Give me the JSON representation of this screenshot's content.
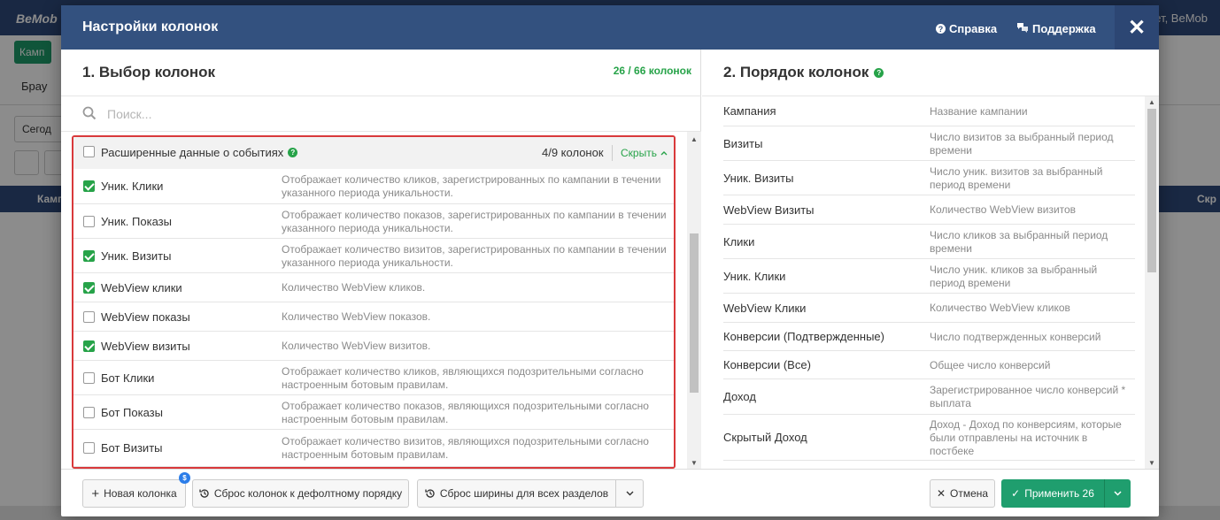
{
  "background": {
    "logo": "BeMob",
    "user_text": "ет, BeMob",
    "campaign_button": "Камп",
    "browser_label": "Брау",
    "date_label": "Сегод",
    "table_col_left": "Камп",
    "table_col_right": "Скр"
  },
  "modal": {
    "title": "Настройки колонок",
    "help_label": "Справка",
    "support_label": "Поддержка",
    "close_symbol": "✕"
  },
  "left": {
    "title": "1. Выбор колонок",
    "count": "26 / 66 колонок",
    "search_placeholder": "Поиск...",
    "group": {
      "label": "Расширенные данные о событиях",
      "count": "4/9 колонок",
      "hide_label": "Скрыть",
      "checked": false
    },
    "rows": [
      {
        "name": "Уник. Клики",
        "checked": true,
        "desc": "Отображает количество кликов, зарегистрированных по кампании в течении указанного периода уникальности."
      },
      {
        "name": "Уник. Показы",
        "checked": false,
        "desc": "Отображает количество показов, зарегистрированных по кампании в течении указанного периода уникальности."
      },
      {
        "name": "Уник. Визиты",
        "checked": true,
        "desc": "Отображает количество визитов, зарегистрированных по кампании в течении указанного периода уникальности."
      },
      {
        "name": "WebView клики",
        "checked": true,
        "desc": "Количество WebView кликов."
      },
      {
        "name": "WebView показы",
        "checked": false,
        "desc": "Количество WebView показов."
      },
      {
        "name": "WebView визиты",
        "checked": true,
        "desc": "Количество WebView визитов."
      },
      {
        "name": "Бот Клики",
        "checked": false,
        "desc": "Отображает количество кликов, являющихся подозрительными согласно настроенным ботовым правилам."
      },
      {
        "name": "Бот Показы",
        "checked": false,
        "desc": "Отображает количество показов, являющихся подозрительными согласно настроенным ботовым правилам."
      },
      {
        "name": "Бот Визиты",
        "checked": false,
        "desc": "Отображает количество визитов, являющихся подозрительными согласно настроенным ботовым правилам."
      }
    ]
  },
  "right": {
    "title": "2. Порядок колонок",
    "rows": [
      {
        "name": "Кампания",
        "desc": "Название кампании"
      },
      {
        "name": "Визиты",
        "desc": "Число визитов за выбранный период времени"
      },
      {
        "name": "Уник. Визиты",
        "desc": "Число уник. визитов за выбранный период времени"
      },
      {
        "name": "WebView Визиты",
        "desc": "Количество WebView визитов"
      },
      {
        "name": "Клики",
        "desc": "Число кликов за выбранный период времени"
      },
      {
        "name": "Уник. Клики",
        "desc": "Число уник. кликов за выбранный период времени"
      },
      {
        "name": "WebView Клики",
        "desc": "Количество WebView кликов"
      },
      {
        "name": "Конверсии (Подтвержденные)",
        "desc": "Число подтвержденных конверсий"
      },
      {
        "name": "Конверсии (Все)",
        "desc": "Общее число конверсий"
      },
      {
        "name": "Доход",
        "desc": "Зарегистрированное число конверсий * выплата"
      },
      {
        "name": "Скрытый Доход",
        "desc": "Доход - Доход по конверсиям, которые были отправлены на источник в постбеке"
      }
    ]
  },
  "footer": {
    "new_column": "Новая колонка",
    "reset_order": "Сброс колонок к дефолтному порядку",
    "reset_width": "Сброс ширины для всех разделов",
    "cancel": "Отмена",
    "apply": "Применить 26"
  },
  "colors": {
    "header_bg": "#33517f",
    "accent_green": "#27a349",
    "apply_green": "#1f9e6e",
    "highlight_red": "#d9393b"
  }
}
